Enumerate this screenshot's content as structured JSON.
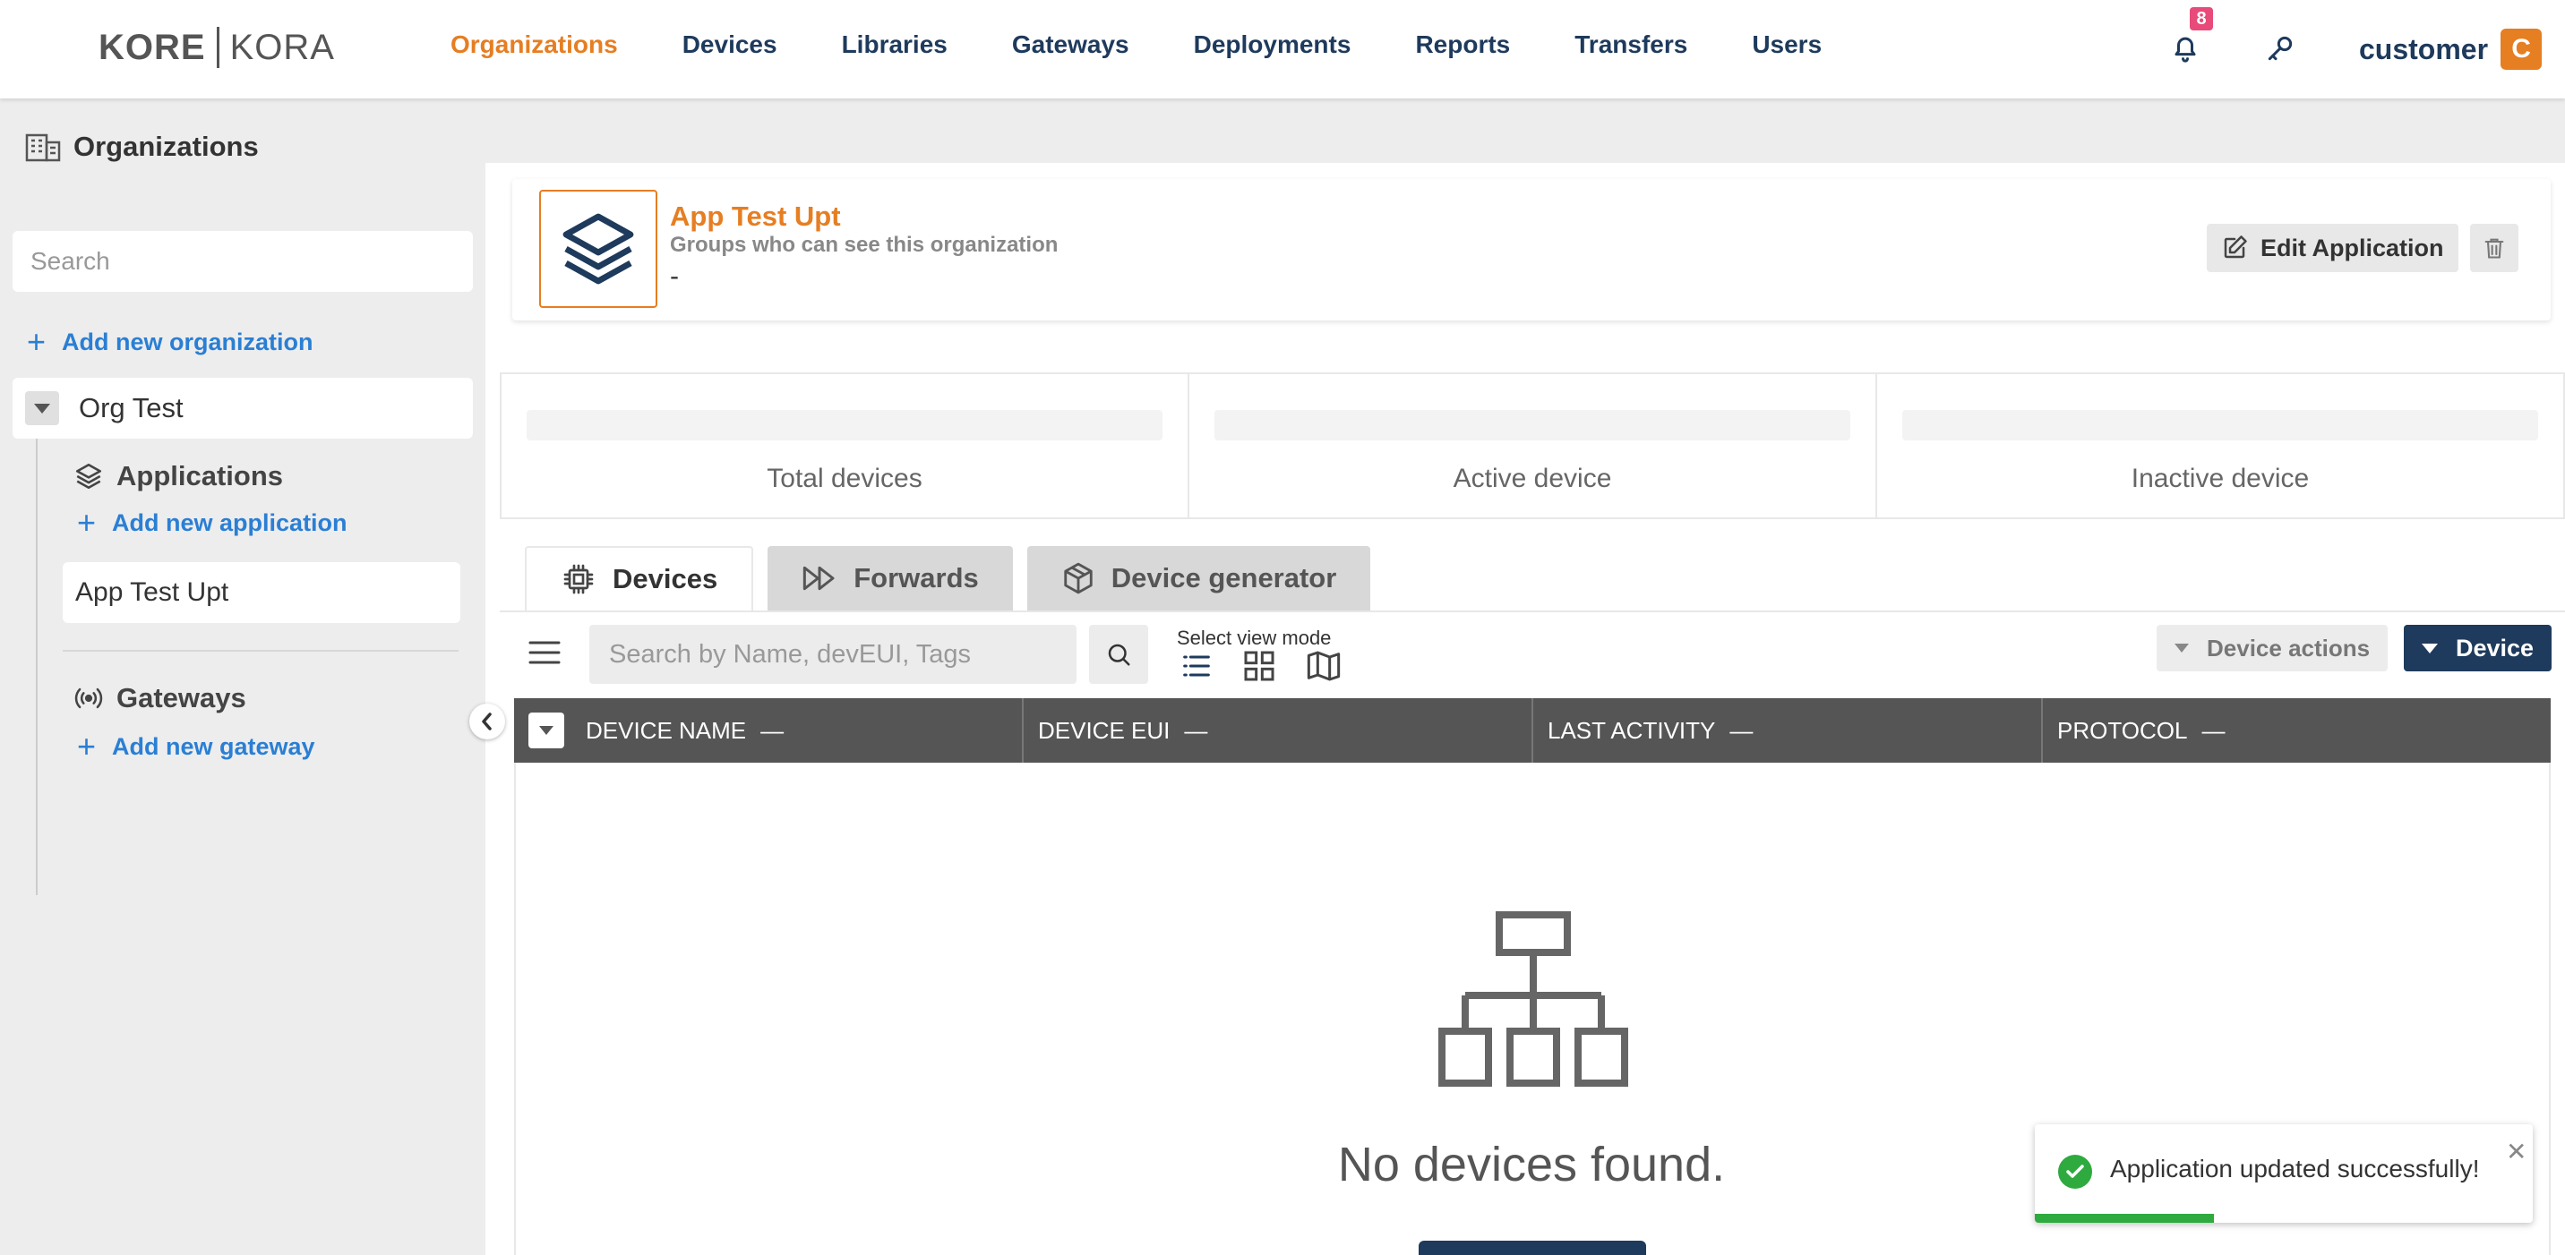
{
  "brand": {
    "left": "KORE",
    "right": "KORA"
  },
  "nav": {
    "items": [
      {
        "label": "Organizations",
        "active": true
      },
      {
        "label": "Devices",
        "active": false
      },
      {
        "label": "Libraries",
        "active": false
      },
      {
        "label": "Gateways",
        "active": false
      },
      {
        "label": "Deployments",
        "active": false
      },
      {
        "label": "Reports",
        "active": false
      },
      {
        "label": "Transfers",
        "active": false
      },
      {
        "label": "Users",
        "active": false
      }
    ],
    "notifications_count": "8",
    "user_name": "customer",
    "user_initial": "C"
  },
  "sidebar": {
    "title": "Organizations",
    "search_placeholder": "Search",
    "add_org": "Add new organization",
    "org_name": "Org Test",
    "applications_label": "Applications",
    "add_application": "Add new application",
    "selected_app": "App Test Upt",
    "gateways_label": "Gateways",
    "add_gateway": "Add new gateway"
  },
  "app_card": {
    "title": "App Test Upt",
    "subtitle": "Groups who can see this organization",
    "groups_value": "-",
    "edit_label": "Edit Application"
  },
  "stats": [
    {
      "label": "Total devices"
    },
    {
      "label": "Active device"
    },
    {
      "label": "Inactive device"
    }
  ],
  "tabs": [
    {
      "label": "Devices",
      "icon": "chip-icon",
      "active": true
    },
    {
      "label": "Forwards",
      "icon": "fast-forward-icon",
      "active": false
    },
    {
      "label": "Device generator",
      "icon": "cube-icon",
      "active": false
    }
  ],
  "toolbar": {
    "search_placeholder": "Search by Name, devEUI, Tags",
    "view_mode_label": "Select view mode",
    "device_actions": "Device actions",
    "device_button": "Device"
  },
  "table": {
    "columns": [
      "DEVICE NAME",
      "DEVICE EUI",
      "LAST ACTIVITY",
      "PROTOCOL"
    ],
    "sort_indicator": "—",
    "empty_message": "No devices found."
  },
  "toast": {
    "message": "Application updated successfully!",
    "progress": 0.36
  },
  "colors": {
    "accent": "#e67e22",
    "navy": "#1e3a5c",
    "link": "#2a7fd4",
    "success": "#2eaa3f",
    "badge": "#e84a7a"
  }
}
